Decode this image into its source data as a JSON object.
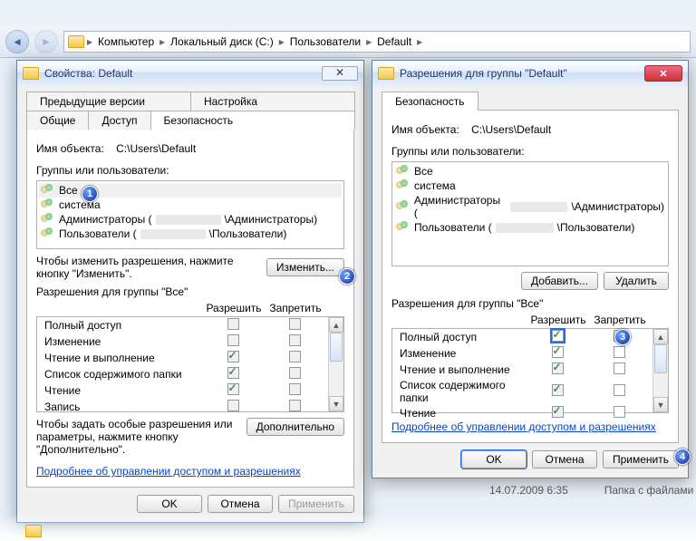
{
  "nav": {
    "crumbs": [
      "Компьютер",
      "Локальный диск (C:)",
      "Пользователи",
      "Default"
    ]
  },
  "left": {
    "title": "Свойства: Default",
    "tabs_row1": [
      "Предыдущие версии",
      "Настройка"
    ],
    "tabs_row2": [
      "Общие",
      "Доступ",
      "Безопасность"
    ],
    "object_label": "Имя объекта:",
    "object_path": "C:\\Users\\Default",
    "groups_label": "Группы или пользователи:",
    "groups": [
      {
        "text": "Все",
        "selected": true
      },
      {
        "text": "система"
      },
      {
        "text_pre": "Администраторы (",
        "smudge": true,
        "text_post": "\\Администраторы)"
      },
      {
        "text_pre": "Пользователи (",
        "smudge": true,
        "text_post": "\\Пользователи)"
      }
    ],
    "change_hint": "Чтобы изменить разрешения, нажмите кнопку \"Изменить\".",
    "btn_change": "Изменить...",
    "perm_caption": "Разрешения для группы \"Все\"",
    "col_allow": "Разрешить",
    "col_deny": "Запретить",
    "perms": [
      {
        "name": "Полный доступ",
        "allow": false
      },
      {
        "name": "Изменение",
        "allow": false
      },
      {
        "name": "Чтение и выполнение",
        "allow": true
      },
      {
        "name": "Список содержимого папки",
        "allow": true
      },
      {
        "name": "Чтение",
        "allow": true
      },
      {
        "name": "Запись",
        "allow": false
      }
    ],
    "adv_hint": "Чтобы задать особые разрешения или параметры, нажмите кнопку \"Дополнительно\".",
    "btn_adv": "Дополнительно",
    "link_more": "Подробнее об управлении доступом и разрешениях",
    "btn_ok": "OK",
    "btn_cancel": "Отмена",
    "btn_apply": "Применить"
  },
  "right": {
    "title": "Разрешения для группы \"Default\"",
    "tab": "Безопасность",
    "object_label": "Имя объекта:",
    "object_path": "C:\\Users\\Default",
    "groups_label": "Группы или пользователи:",
    "groups": [
      {
        "text": "Все"
      },
      {
        "text": "система"
      },
      {
        "text_pre": "Администраторы (",
        "smudge": true,
        "text_post": "\\Администраторы)"
      },
      {
        "text_pre": "Пользователи (",
        "smudge": true,
        "text_post": "\\Пользователи)"
      }
    ],
    "btn_add": "Добавить...",
    "btn_remove": "Удалить",
    "perm_caption": "Разрешения для группы \"Все\"",
    "col_allow": "Разрешить",
    "col_deny": "Запретить",
    "perms": [
      {
        "name": "Полный доступ",
        "allow": true,
        "deny": false,
        "allow_hl": true
      },
      {
        "name": "Изменение",
        "allow": true,
        "deny": false
      },
      {
        "name": "Чтение и выполнение",
        "allow": true,
        "deny": false
      },
      {
        "name": "Список содержимого папки",
        "allow": true,
        "deny": false
      },
      {
        "name": "Чтение",
        "allow": true,
        "deny": false
      }
    ],
    "link_more": "Подробнее об управлении доступом и разрешениях",
    "btn_ok": "OK",
    "btn_cancel": "Отмена",
    "btn_apply": "Применить"
  },
  "filelist": {
    "date": "14.07.2009 6:35",
    "type": "Папка с файлами"
  },
  "callouts": {
    "c1": "1",
    "c2": "2",
    "c3": "3",
    "c4": "4"
  }
}
